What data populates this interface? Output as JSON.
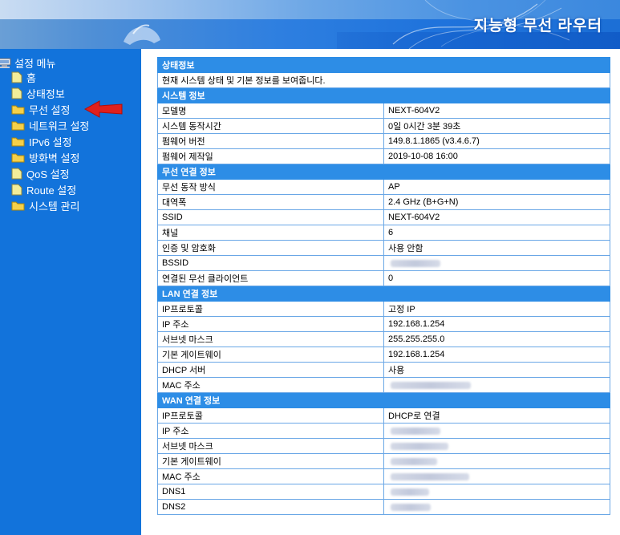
{
  "header": {
    "title": "지능형 무선 라우터"
  },
  "sidebar": {
    "root_label": "설정 메뉴",
    "items": [
      {
        "label": "홈",
        "icon": "document-icon"
      },
      {
        "label": "상태정보",
        "icon": "document-icon"
      },
      {
        "label": "무선 설정",
        "icon": "folder-icon"
      },
      {
        "label": "네트워크 설정",
        "icon": "folder-icon"
      },
      {
        "label": "IPv6 설정",
        "icon": "folder-icon"
      },
      {
        "label": "방화벽 설정",
        "icon": "folder-icon"
      },
      {
        "label": "QoS 설정",
        "icon": "document-icon"
      },
      {
        "label": "Route 설정",
        "icon": "document-icon"
      },
      {
        "label": "시스템 관리",
        "icon": "folder-icon"
      }
    ]
  },
  "main": {
    "status": {
      "title": "상태정보",
      "description": "현재 시스템 상태 및 기본 정보를 보여줍니다."
    },
    "system": {
      "title": "시스템 정보",
      "rows": [
        {
          "label": "모델명",
          "value": "NEXT-604V2"
        },
        {
          "label": "시스템 동작시간",
          "value": "0일 0시간 3분 39초"
        },
        {
          "label": "펌웨어 버전",
          "value": "149.8.1.1865 (v3.4.6.7)"
        },
        {
          "label": "펌웨어 제작일",
          "value": "2019-10-08 16:00"
        }
      ]
    },
    "wireless": {
      "title": "무선 연결 정보",
      "rows": [
        {
          "label": "무선 동작 방식",
          "value": "AP"
        },
        {
          "label": "대역폭",
          "value": "2.4 GHz (B+G+N)"
        },
        {
          "label": "SSID",
          "value": "NEXT-604V2"
        },
        {
          "label": "채널",
          "value": "6"
        },
        {
          "label": "인증 및 암호화",
          "value": "사용 안함"
        },
        {
          "label": "BSSID",
          "value": ""
        },
        {
          "label": "연결된 무선 클라이언트",
          "value": "0"
        }
      ]
    },
    "lan": {
      "title": "LAN 연결 정보",
      "rows": [
        {
          "label": "IP프로토콜",
          "value": "고정 IP"
        },
        {
          "label": "IP 주소",
          "value": "192.168.1.254"
        },
        {
          "label": "서브넷 마스크",
          "value": "255.255.255.0"
        },
        {
          "label": "기본 게이트웨이",
          "value": "192.168.1.254"
        },
        {
          "label": "DHCP 서버",
          "value": "사용"
        },
        {
          "label": "MAC 주소",
          "value": ""
        }
      ]
    },
    "wan": {
      "title": "WAN 연결 정보",
      "rows": [
        {
          "label": "IP프로토콜",
          "value": "DHCP로 연결"
        },
        {
          "label": "IP 주소",
          "value": ""
        },
        {
          "label": "서브넷 마스크",
          "value": ""
        },
        {
          "label": "기본 게이트웨이",
          "value": ""
        },
        {
          "label": "MAC 주소",
          "value": ""
        },
        {
          "label": "DNS1",
          "value": ""
        },
        {
          "label": "DNS2",
          "value": ""
        }
      ]
    }
  },
  "colors": {
    "sidebar_bg": "#1273db",
    "section_header_bg": "#2d8de6",
    "table_border": "#6aa7e6",
    "folder_yellow": "#f5d04a",
    "arrow_red": "#e0201c"
  }
}
